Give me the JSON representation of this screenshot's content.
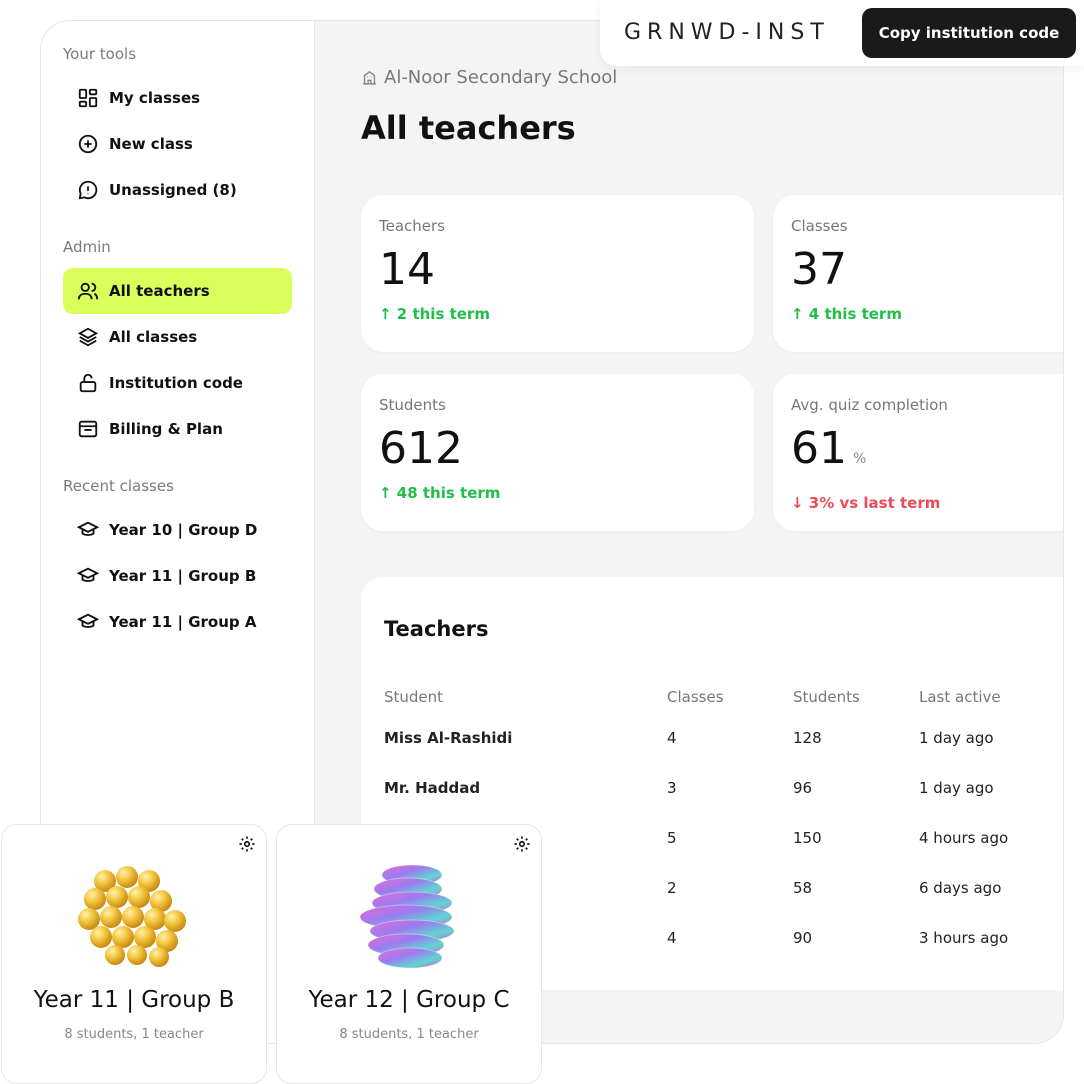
{
  "sidebar": {
    "sections": {
      "tools": "Your tools",
      "admin": "Admin",
      "recent": "Recent classes"
    },
    "tools": [
      "My classes",
      "New class",
      "Unassigned (8)"
    ],
    "admin": [
      "All teachers",
      "All classes",
      "Institution code",
      "Billing & Plan"
    ],
    "recent": [
      "Year 10 | Group D",
      "Year 11 | Group B",
      "Year 11 | Group A"
    ],
    "active_item": "All teachers",
    "accent_color": "#d9ff5c"
  },
  "topbar": {
    "institution_code": "GRNWD-INST",
    "copy_button": "Copy institution code"
  },
  "main": {
    "school_name": "Al-Noor Secondary School",
    "page_title": "All teachers",
    "stats": [
      {
        "label": "Teachers",
        "value": "14",
        "unit": "",
        "delta": "↑ 2 this term",
        "trend": "up"
      },
      {
        "label": "Classes",
        "value": "37",
        "unit": "",
        "delta": "↑ 4 this term",
        "trend": "up"
      },
      {
        "label": "Students",
        "value": "612",
        "unit": "",
        "delta": "↑ 48 this term",
        "trend": "up"
      },
      {
        "label": "Avg. quiz completion",
        "value": "61",
        "unit": "%",
        "delta": "↓ 3% vs last term",
        "trend": "down"
      }
    ],
    "colors": {
      "up": "#1fbf4a",
      "down": "#ef4b55"
    },
    "table": {
      "title": "Teachers",
      "columns": [
        "Student",
        "Classes",
        "Students",
        "Last active"
      ],
      "rows": [
        [
          "Miss Al-Rashidi",
          "4",
          "128",
          "1 day ago"
        ],
        [
          "Mr. Haddad",
          "3",
          "96",
          "1 day ago"
        ],
        [
          "",
          "5",
          "150",
          "4 hours ago"
        ],
        [
          "",
          "2",
          "58",
          "6 days ago"
        ],
        [
          "",
          "4",
          "90",
          "3 hours ago"
        ]
      ]
    }
  },
  "class_cards": [
    {
      "name": "Year 11 | Group B",
      "meta": "8 students, 1 teacher",
      "icon": "gear-icon",
      "art": "golden-spheres"
    },
    {
      "name": "Year 12 | Group C",
      "meta": "8 students, 1 teacher",
      "icon": "gear-icon",
      "art": "iridescent-twisted-shape"
    }
  ]
}
